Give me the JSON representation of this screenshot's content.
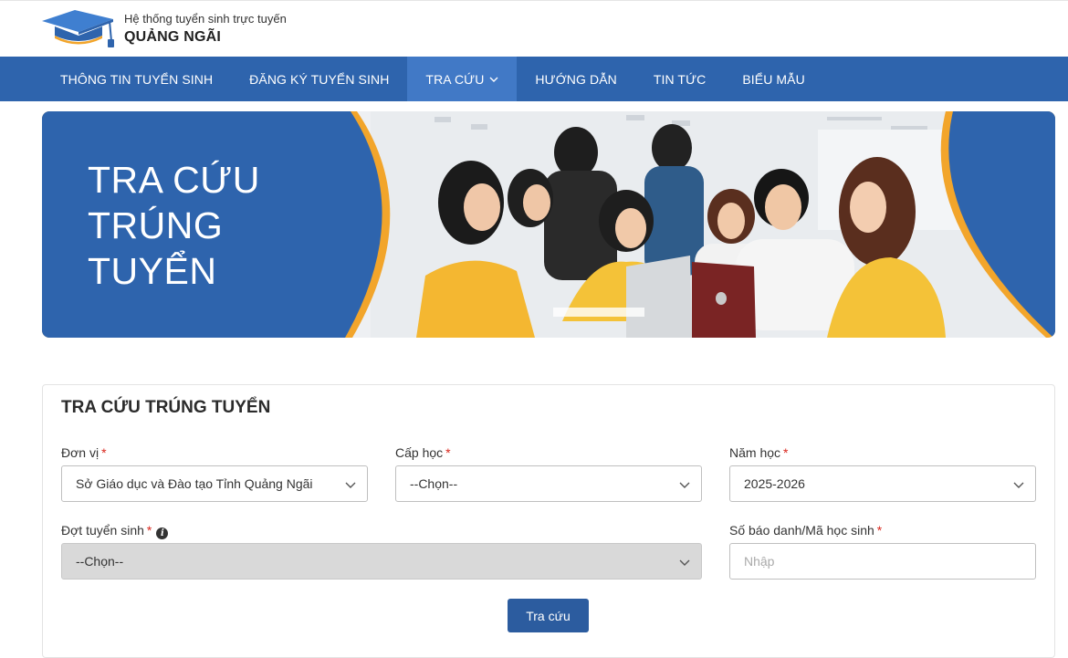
{
  "header": {
    "subtitle": "Hệ thống tuyển sinh trực tuyến",
    "name": "QUẢNG NGÃI"
  },
  "nav": {
    "items": [
      {
        "label": "THÔNG TIN TUYỂN SINH",
        "active": false
      },
      {
        "label": "ĐĂNG KÝ TUYỂN SINH",
        "active": false
      },
      {
        "label": "TRA CỨU",
        "active": true,
        "has_dropdown": true
      },
      {
        "label": "HƯỚNG DẪN",
        "active": false
      },
      {
        "label": "TIN TỨC",
        "active": false
      },
      {
        "label": "BIỂU MẪU",
        "active": false
      }
    ]
  },
  "banner": {
    "line1": "TRA CỨU",
    "line2": "TRÚNG",
    "line3": "TUYỂN"
  },
  "form": {
    "title": "TRA CỨU TRÚNG TUYỂN",
    "required_mark": "*",
    "don_vi": {
      "label": "Đơn vị",
      "value": "Sở Giáo dục và Đào tạo Tỉnh Quảng Ngãi"
    },
    "cap_hoc": {
      "label": "Cấp học",
      "value": "--Chọn--"
    },
    "nam_hoc": {
      "label": "Năm học",
      "value": "2025-2026"
    },
    "dot_tuyen_sinh": {
      "label": "Đợt tuyển sinh",
      "value": "--Chọn--",
      "disabled": true
    },
    "so_bao_danh": {
      "label": "Số báo danh/Mã học sinh",
      "placeholder": "Nhập",
      "value": ""
    },
    "submit_label": "Tra cứu"
  },
  "colors": {
    "nav_bg": "#2e64ad",
    "nav_active": "#4179c6",
    "banner_blue": "#2e64ad",
    "banner_accent": "#f2a52b",
    "button": "#2c5c9f",
    "required": "#d9261c"
  }
}
